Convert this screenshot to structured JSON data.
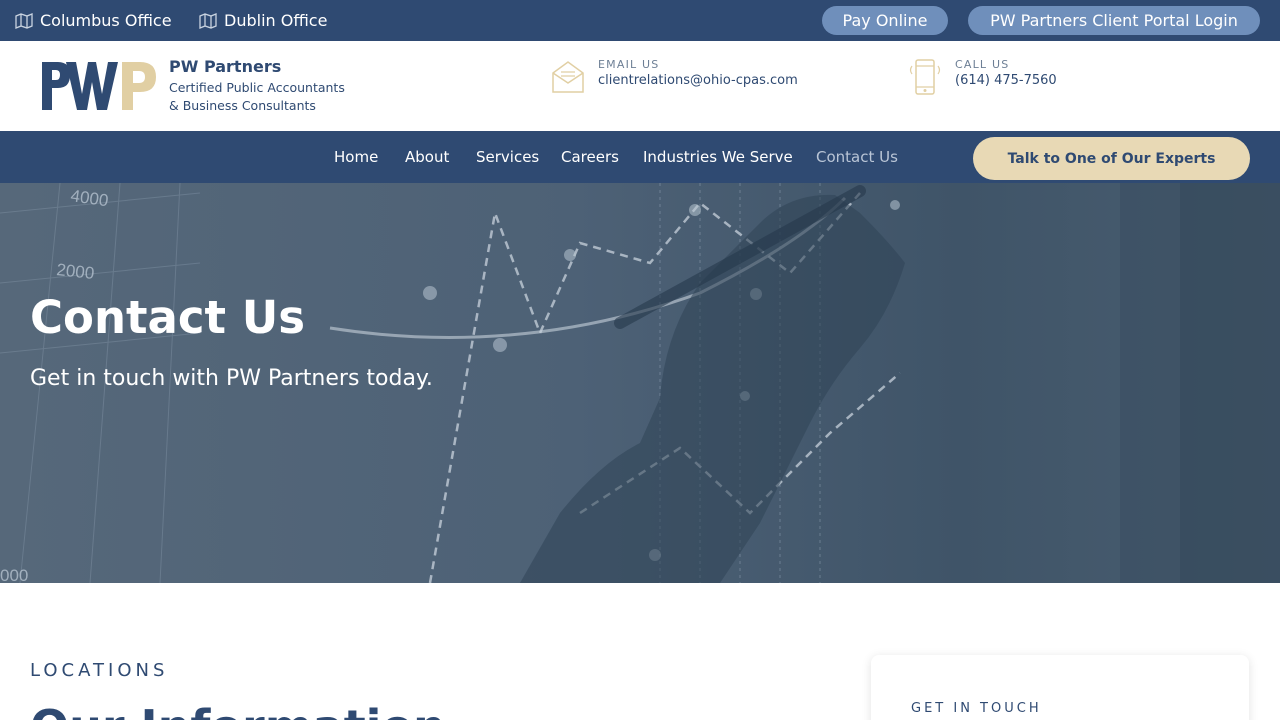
{
  "topbar": {
    "offices": [
      "Columbus Office",
      "Dublin Office"
    ],
    "pay_online": "Pay Online",
    "portal_login": "PW Partners Client Portal Login"
  },
  "header": {
    "logo_icon": "pwp-logo",
    "brand_name": "PW Partners",
    "brand_line1": "Certified Public Accountants",
    "brand_line2": "& Business Consultants",
    "email_label": "EMAIL US",
    "email_value": "clientrelations@ohio-cpas.com",
    "email_icon": "envelope-icon",
    "phone_label": "CALL US",
    "phone_value": "(614) 475-7560",
    "phone_icon": "phone-icon"
  },
  "nav": {
    "items": [
      "Home",
      "About",
      "Services",
      "Careers",
      "Industries We Serve",
      "Contact Us"
    ],
    "active": "Contact Us",
    "cta": "Talk to One of Our Experts"
  },
  "hero": {
    "title": "Contact Us",
    "subtitle": "Get in touch with PW Partners today.",
    "chart_labels": [
      "4000",
      "2000",
      "000"
    ]
  },
  "content": {
    "eyebrow": "LOCATIONS",
    "title": "Our Information",
    "card_eyebrow": "GET IN TOUCH"
  },
  "colors": {
    "primary": "#2f4a72",
    "pill": "#6f8fbb",
    "accent": "#e8d9b5",
    "hero_overlay": "#4a5e72"
  }
}
